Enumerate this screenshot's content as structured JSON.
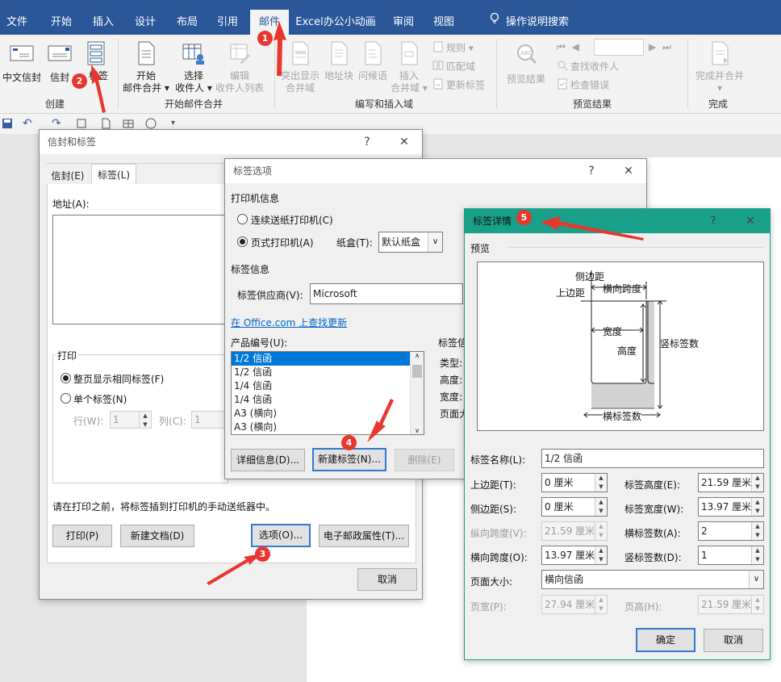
{
  "tabs": [
    "文件",
    "开始",
    "插入",
    "设计",
    "布局",
    "引用",
    "邮件",
    "Excel办公小动画",
    "审阅",
    "视图",
    "操作说明搜索"
  ],
  "ribbon": {
    "create": {
      "envelopes": "中文信封",
      "envelope": "信封",
      "labels": "标签",
      "group": "创建"
    },
    "start": {
      "start_merge": [
        "开始",
        "邮件合并"
      ],
      "select_recipients": [
        "选择",
        "收件人"
      ],
      "edit_recipients": [
        "编辑",
        "收件人列表"
      ],
      "group": "开始邮件合并"
    },
    "write": {
      "highlight": [
        "突出显示",
        "合并域"
      ],
      "address_block": "地址块",
      "greeting": "问候语",
      "insert_field": [
        "插入",
        "合并域"
      ],
      "rules": "规则",
      "match_fields": "匹配域",
      "update_labels": "更新标签",
      "group": "编写和插入域"
    },
    "preview": {
      "preview_results": "预览结果",
      "find_recipient": "查找收件人",
      "check_errors": "检查错误",
      "group": "预览结果"
    },
    "finish": {
      "finish_merge": [
        "完成并合并"
      ],
      "group": "完成"
    },
    "brand_color": "#2b579a"
  },
  "env_dlg": {
    "title": "信封和标签",
    "help": "?",
    "close": "✕",
    "tab_env": "信封(E)",
    "tab_lbl": "标签(L)",
    "address_label": "地址(A):",
    "print_group": "打印",
    "full_page": "整页显示相同标签(F)",
    "single": "单个标签(N)",
    "row": "行(W):",
    "row_val": "1",
    "col": "列(C):",
    "col_val": "1",
    "notice": "请在打印之前，将标签插到打印机的手动送纸器中。",
    "print_btn": "打印(P)",
    "new_doc_btn": "新建文档(D)",
    "options_btn": "选项(O)...",
    "epostage_btn": "电子邮政属性(T)...",
    "cancel_btn": "取消"
  },
  "opt_dlg": {
    "title": "标签选项",
    "help": "?",
    "close": "✕",
    "printer_info": "打印机信息",
    "continuous": "连续送纸打印机(C)",
    "page_printer": "页式打印机(A)",
    "tray_label": "纸盒(T):",
    "tray_val": "默认纸盒",
    "label_info": "标签信息",
    "vendor_label": "标签供应商(V):",
    "vendor_val": "Microsoft",
    "office_link": "在 Office.com 上查找更新",
    "product_label": "产品编号(U):",
    "products": [
      "1/2 信函",
      "1/2 信函",
      "1/4 信函",
      "1/4 信函",
      "A3 (横向)",
      "A3 (横向)"
    ],
    "right_head": "标签信",
    "right_items": [
      "类型:",
      "高度:",
      "宽度:",
      "页面大"
    ],
    "details_btn": "详细信息(D)...",
    "new_label_btn": "新建标签(N)...",
    "delete_btn": "删除(E)"
  },
  "det_dlg": {
    "title": "标签详情",
    "help": "?",
    "close": "✕",
    "accent": "#19a08a",
    "preview_label": "预览",
    "diagram": {
      "side_margin": "侧边距",
      "top_margin": "上边距",
      "h_pitch": "横向跨度",
      "width": "宽度",
      "height": "高度",
      "v_count": "竖标签数",
      "h_count": "横标签数"
    },
    "name_label": "标签名称(L):",
    "name_val": "1/2 信函",
    "top_margin_label": "上边距(T):",
    "top_margin_val": "0 厘米",
    "label_height_label": "标签高度(E):",
    "label_height_val": "21.59 厘米",
    "side_margin_label": "侧边距(S):",
    "side_margin_val": "0 厘米",
    "label_width_label": "标签宽度(W):",
    "label_width_val": "13.97 厘米",
    "v_pitch_label": "纵向跨度(V):",
    "v_pitch_val": "21.59 厘米",
    "h_count_label": "横标签数(A):",
    "h_count_val": "2",
    "h_pitch_label": "横向跨度(O):",
    "h_pitch_val": "13.97 厘米",
    "v_count_label": "竖标签数(D):",
    "v_count_val": "1",
    "page_size_label": "页面大小:",
    "page_size_val": "横向信函",
    "page_width_label": "页宽(P):",
    "page_width_val": "27.94 厘米",
    "page_height_label": "页高(H):",
    "page_height_val": "21.59 厘米",
    "ok_btn": "确定",
    "cancel_btn": "取消"
  },
  "markers": [
    "1",
    "2",
    "3",
    "4",
    "5"
  ],
  "marker_color": "#e8372f"
}
